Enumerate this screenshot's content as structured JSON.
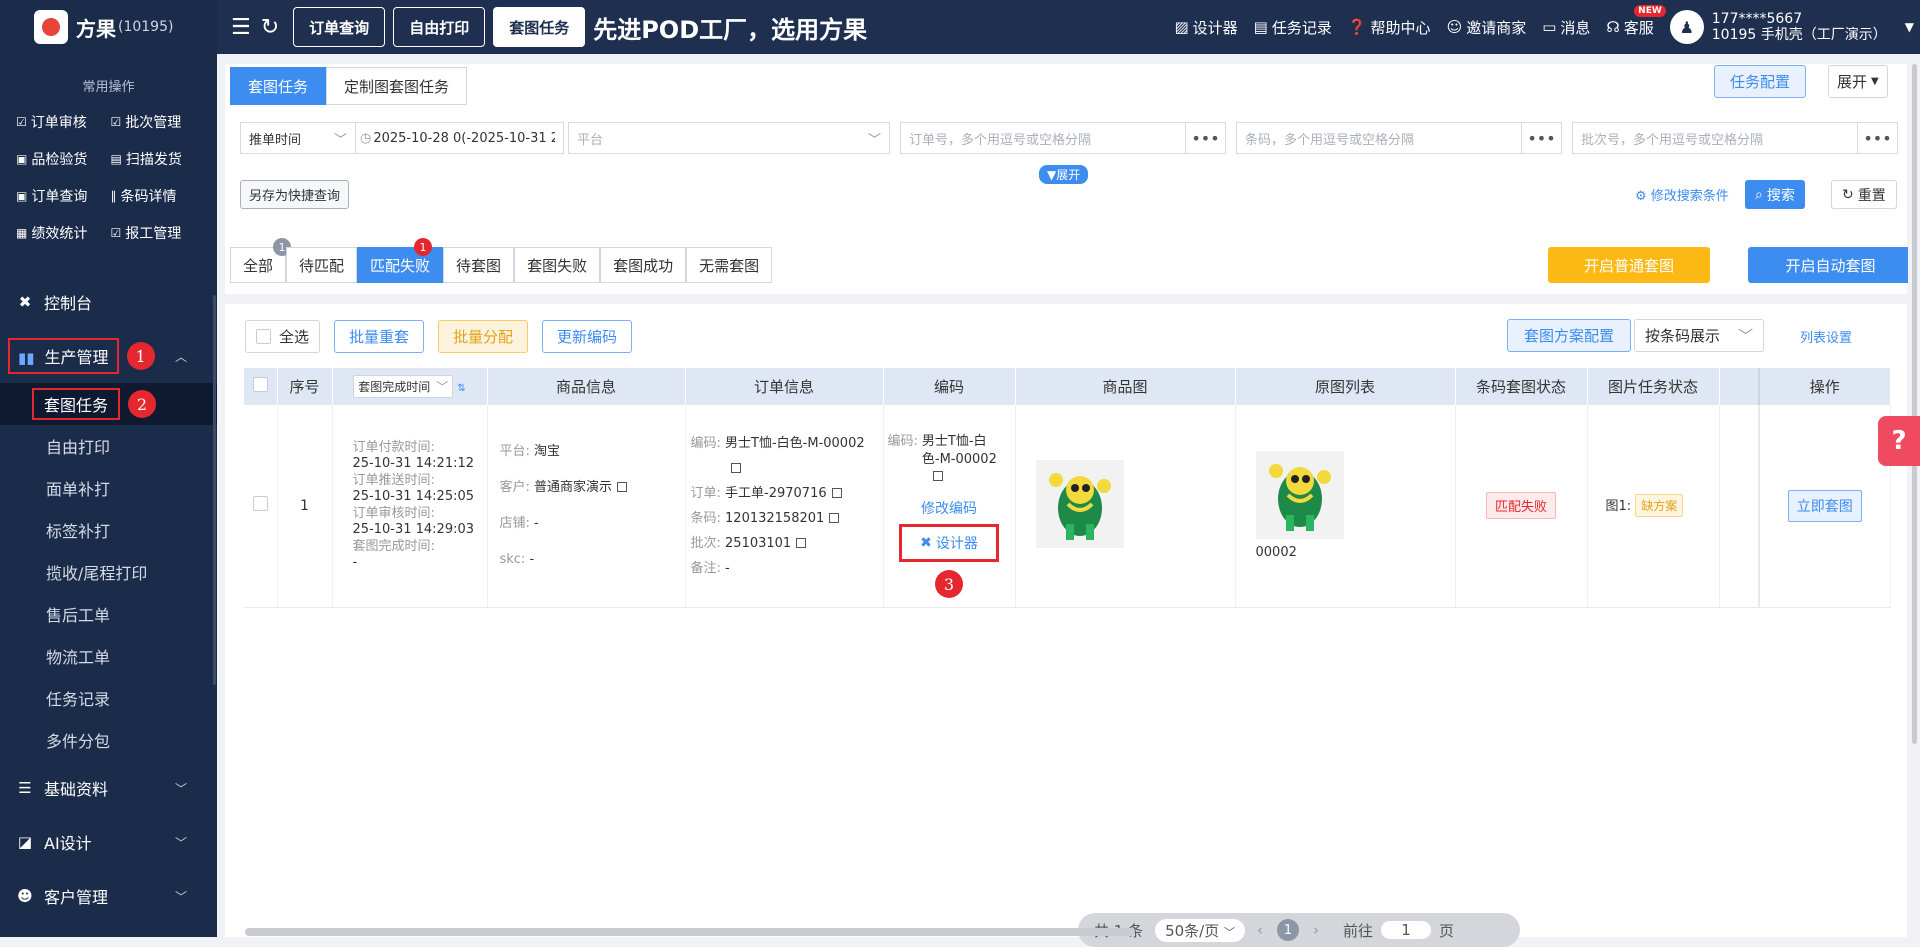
{
  "brand": {
    "name": "方果",
    "id": "(10195)"
  },
  "sidebar": {
    "quick_title": "常用操作",
    "quick": [
      {
        "icon": "☑",
        "label": "订单审核"
      },
      {
        "icon": "☑",
        "label": "批次管理"
      },
      {
        "icon": "▣",
        "label": "品检验货"
      },
      {
        "icon": "▤",
        "label": "扫描发货"
      },
      {
        "icon": "▣",
        "label": "订单查询"
      },
      {
        "icon": "∥",
        "label": "条码详情"
      },
      {
        "icon": "▦",
        "label": "绩效统计"
      },
      {
        "icon": "☑",
        "label": "报工管理"
      }
    ],
    "groups": {
      "console": "控制台",
      "production": "生产管理",
      "basic": "基础资料",
      "ai": "AI设计",
      "customer": "客户管理"
    },
    "sub": [
      "套图任务",
      "自由打印",
      "面单补打",
      "标签补打",
      "揽收/尾程打印",
      "售后工单",
      "物流工单",
      "任务记录",
      "多件分包"
    ],
    "badges": [
      "1",
      "2",
      "3"
    ]
  },
  "topbar": {
    "tabs": [
      "订单查询",
      "自由打印",
      "套图任务"
    ],
    "slogan": "先进POD工厂，选用方果",
    "links": [
      "设计器",
      "任务记录",
      "帮助中心",
      "邀请商家",
      "消息",
      "客服"
    ],
    "new_badge": "NEW",
    "user_phone": "177****5667",
    "user_line2": "10195 手机壳（工厂演示）"
  },
  "tabs": [
    "套图任务",
    "定制图套图任务"
  ],
  "task_config": "任务配置",
  "expand": "展开",
  "filters": {
    "time_type": "推单时间",
    "date_range": "2025-10-28 0(-2025-10-31 2:",
    "platform": "平台",
    "order_ph": "订单号，多个用逗号或空格分隔",
    "code_ph": "条码，多个用逗号或空格分隔",
    "batch_ph": "批次号，多个用逗号或空格分隔",
    "expand_pill": "▼展开",
    "save_quick": "另存为快捷查询",
    "modify_search": "修改搜索条件",
    "search": "搜索",
    "reset": "重置"
  },
  "status_tabs": [
    {
      "label": "全部",
      "count": "1"
    },
    {
      "label": "待匹配"
    },
    {
      "label": "匹配失败",
      "count": "1"
    },
    {
      "label": "待套图"
    },
    {
      "label": "套图失败"
    },
    {
      "label": "套图成功"
    },
    {
      "label": "无需套图"
    }
  ],
  "btn_normal": "开启普通套图",
  "btn_auto": "开启自动套图",
  "toolbar": {
    "select_all": "全选",
    "batch_reset": "批量重套",
    "batch_assign": "批量分配",
    "update_code": "更新编码",
    "plan_config": "套图方案配置",
    "display": "按条码展示",
    "list_settings": "列表设置"
  },
  "columns": [
    "序号",
    "套图完成时间",
    "商品信息",
    "订单信息",
    "编码",
    "商品图",
    "原图列表",
    "条码套图状态",
    "图片任务状态",
    "操作"
  ],
  "row": {
    "index": "1",
    "times": [
      {
        "k": "订单付款时间:",
        "v": "25-10-31 14:21:12"
      },
      {
        "k": "订单推送时间:",
        "v": "25-10-31 14:25:05"
      },
      {
        "k": "订单审核时间:",
        "v": "25-10-31 14:29:03"
      },
      {
        "k": "套图完成时间:",
        "v": "-"
      }
    ],
    "product": [
      {
        "k": "平台:",
        "v": "淘宝"
      },
      {
        "k": "客户:",
        "v": "普通商家演示"
      },
      {
        "k": "店铺:",
        "v": "-"
      },
      {
        "k": "skc:",
        "v": "-"
      }
    ],
    "order": [
      {
        "k": "编码:",
        "v": "男士T恤-白色-M-00002"
      },
      {
        "k": "订单:",
        "v": "手工单-2970716"
      },
      {
        "k": "条码:",
        "v": "120132158201"
      },
      {
        "k": "批次:",
        "v": "25103101"
      },
      {
        "k": "备注:",
        "v": "-"
      }
    ],
    "code_label": "编码:",
    "code_value": "男士T恤-白色-M-00002",
    "edit_code": "修改编码",
    "designer": "设计器",
    "orig_caption": "00002",
    "barcode_status": "匹配失败",
    "img_task_label": "图1:",
    "img_task_status": "缺方案",
    "action": "立即套图"
  },
  "pager": {
    "total": "共 1 条",
    "per_page": "50条/页",
    "page": "1",
    "goto": "前往",
    "goto_val": "1",
    "page_unit": "页"
  }
}
